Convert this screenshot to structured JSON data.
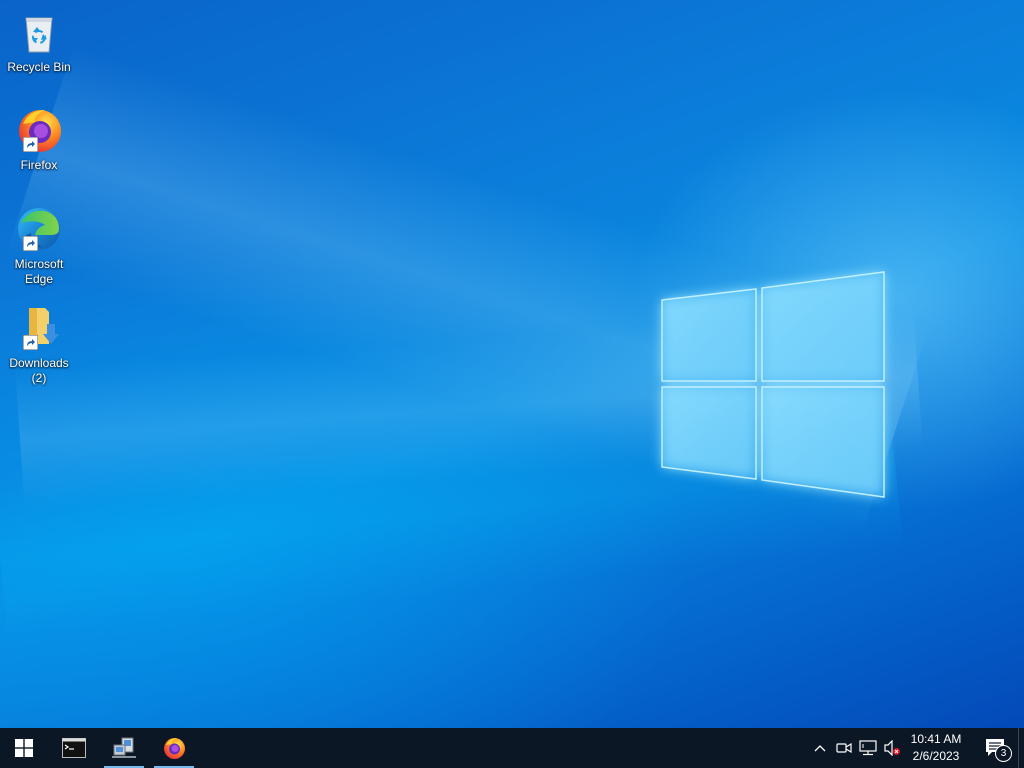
{
  "desktop": {
    "icons": [
      {
        "label": "Recycle Bin",
        "icon": "recycle-bin-icon"
      },
      {
        "label": "Firefox",
        "icon": "firefox-icon"
      },
      {
        "label": "Microsoft\nEdge",
        "icon": "edge-icon"
      },
      {
        "label": "Downloads\n(2)",
        "icon": "downloads-folder-icon"
      }
    ]
  },
  "taskbar": {
    "start": {
      "icon": "windows-start-icon"
    },
    "apps": [
      {
        "icon": "command-prompt-icon",
        "running": false
      },
      {
        "icon": "network-computers-icon",
        "running": true
      },
      {
        "icon": "firefox-icon",
        "running": true
      }
    ],
    "tray": {
      "icons": [
        "chevron-up-icon",
        "meet-now-icon",
        "network-icon",
        "volume-muted-icon"
      ],
      "time": "10:41 AM",
      "date": "2/6/2023",
      "notification_count": "3"
    }
  },
  "colors": {
    "taskbar": "#0c1726",
    "desktop_primary": "#0a7ad8",
    "accent": "#76b9ed"
  }
}
